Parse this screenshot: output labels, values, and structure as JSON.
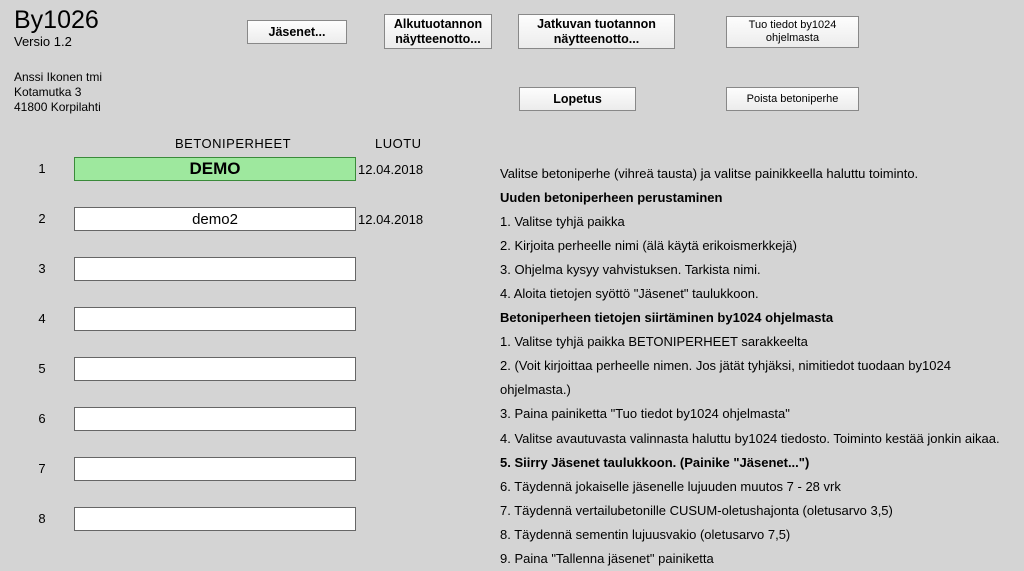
{
  "app": {
    "title": "By1026",
    "version": "Versio 1.2",
    "company_line1": "Anssi Ikonen tmi",
    "company_line2": "Kotamutka 3",
    "company_line3": "41800 Korpilahti"
  },
  "buttons": {
    "jasenet": "Jäsenet...",
    "alkutuotanto": "Alkutuotannon näytteenotto...",
    "jatkuva": "Jatkuvan tuotannon näytteenotto...",
    "tuo": "Tuo tiedot by1024 ohjelmasta",
    "lopetus": "Lopetus",
    "poista": "Poista betoniperhe"
  },
  "headers": {
    "families": "BETONIPERHEET",
    "created": "LUOTU"
  },
  "rows": [
    {
      "num": "1",
      "name": "DEMO",
      "date": "12.04.2018",
      "selected": true
    },
    {
      "num": "2",
      "name": "demo2",
      "date": "12.04.2018",
      "selected": false
    },
    {
      "num": "3",
      "name": "",
      "date": "",
      "selected": false
    },
    {
      "num": "4",
      "name": "",
      "date": "",
      "selected": false
    },
    {
      "num": "5",
      "name": "",
      "date": "",
      "selected": false
    },
    {
      "num": "6",
      "name": "",
      "date": "",
      "selected": false
    },
    {
      "num": "7",
      "name": "",
      "date": "",
      "selected": false
    },
    {
      "num": "8",
      "name": "",
      "date": "",
      "selected": false
    }
  ],
  "instructions": {
    "intro": "Valitse betoniperhe (vihreä tausta) ja valitse painikkeella haluttu toiminto.",
    "section1": "Uuden betoniperheen perustaminen",
    "s1_1": "1. Valitse tyhjä paikka",
    "s1_2": "2. Kirjoita perheelle nimi (älä käytä erikoismerkkejä)",
    "s1_3": "3. Ohjelma kysyy vahvistuksen. Tarkista nimi.",
    "s1_4": "4. Aloita tietojen syöttö \"Jäsenet\" taulukkoon.",
    "section2": "Betoniperheen tietojen siirtäminen by1024 ohjelmasta",
    "s2_1": "1. Valitse tyhjä paikka BETONIPERHEET sarakkeelta",
    "s2_2": "2. (Voit kirjoittaa perheelle nimen. Jos jätät tyhjäksi, nimitiedot tuodaan by1024 ohjelmasta.)",
    "s2_3": "3. Paina painiketta \"Tuo tiedot by1024 ohjelmasta\"",
    "s2_4": "4. Valitse avautuvasta valinnasta haluttu by1024 tiedosto. Toiminto kestää jonkin aikaa.",
    "s2_5": "5. Siirry Jäsenet taulukkoon. (Painike \"Jäsenet...\")",
    "s2_6": "6. Täydennä jokaiselle jäsenelle lujuuden muutos 7 - 28 vrk",
    "s2_7": "7. Täydennä vertailubetonille CUSUM-oletushajonta (oletusarvo 3,5)",
    "s2_8": "8. Täydennä sementin lujuusvakio (oletusarvo 7,5)",
    "s2_9": "9. Paina \"Tallenna jäsenet\" painiketta"
  }
}
